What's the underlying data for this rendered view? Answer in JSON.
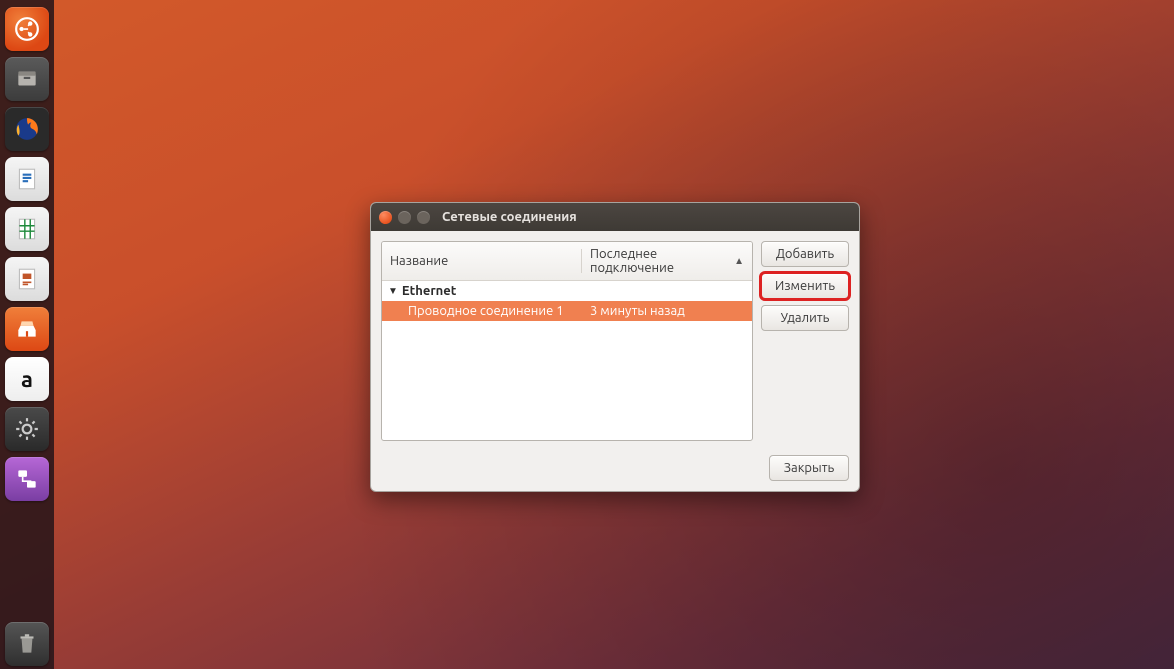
{
  "launcher": {
    "items": [
      {
        "name": "dash-home"
      },
      {
        "name": "files"
      },
      {
        "name": "firefox"
      },
      {
        "name": "libreoffice-writer"
      },
      {
        "name": "libreoffice-calc"
      },
      {
        "name": "libreoffice-impress"
      },
      {
        "name": "ubuntu-software"
      },
      {
        "name": "amazon"
      },
      {
        "name": "system-settings"
      },
      {
        "name": "network-connections-editor"
      }
    ],
    "trash": "trash"
  },
  "window": {
    "title": "Сетевые соединения",
    "columns": {
      "name": "Название",
      "last_used": "Последнее подключение"
    },
    "group": "Ethernet",
    "connection": {
      "name": "Проводное соединение 1",
      "last_used": "3 минуты назад",
      "selected": true
    },
    "buttons": {
      "add": "Добавить",
      "edit": "Изменить",
      "delete": "Удалить",
      "close": "Закрыть"
    }
  }
}
